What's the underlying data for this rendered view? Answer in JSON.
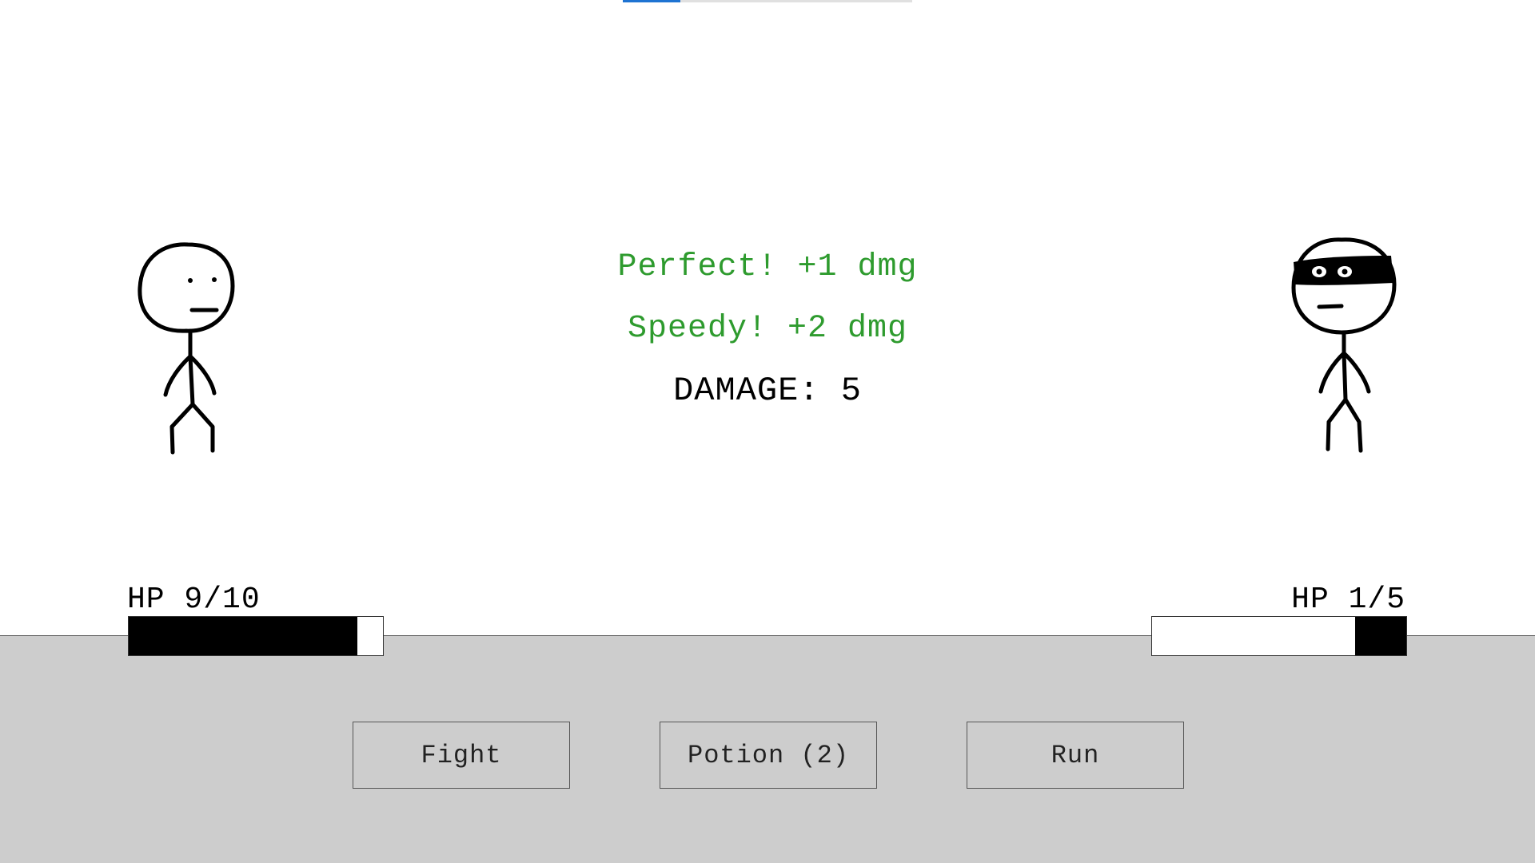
{
  "progress": {
    "fraction": 0.2,
    "accent_color": "#1e73d2"
  },
  "combat_log": {
    "lines": [
      "Perfect! +1 dmg",
      "Speedy! +2 dmg"
    ],
    "line_color": "#2e9b2e",
    "damage_text": "DAMAGE: 5"
  },
  "player": {
    "hp_label": "HP 9/10",
    "hp_current": 9,
    "hp_max": 10
  },
  "enemy": {
    "hp_label": "HP 1/5",
    "hp_current": 1,
    "hp_max": 5
  },
  "actions": {
    "fight_label": "Fight",
    "potion_label": "Potion (2)",
    "run_label": "Run"
  },
  "colors": {
    "ground": "#cdcdcd",
    "hp_fill": "#000000"
  }
}
